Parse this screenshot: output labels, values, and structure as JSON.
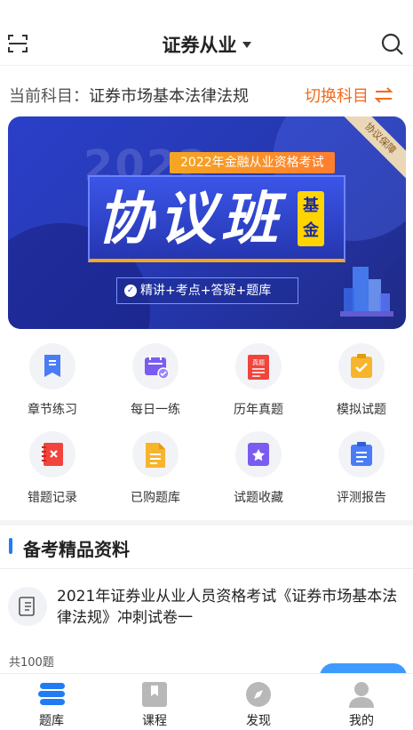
{
  "header": {
    "title": "证券从业"
  },
  "subject": {
    "label": "当前科目：",
    "value": "证券市场基本法律法规",
    "switch_label": "切换科目"
  },
  "banner": {
    "bg_year": "2022",
    "tag": "2022年金融从业资格考试",
    "title": "协议班",
    "badge": "基金",
    "subtitle": "精讲+考点+答疑+题库",
    "corner": "协议保障"
  },
  "grid": [
    {
      "label": "章节练习",
      "icon": "bookmark-icon",
      "color": "#4a7cf6"
    },
    {
      "label": "每日一练",
      "icon": "calendar-check-icon",
      "color": "#7a5cf0"
    },
    {
      "label": "历年真题",
      "icon": "exam-paper-icon",
      "color": "#f0443c",
      "icon_text": "真题"
    },
    {
      "label": "模拟试题",
      "icon": "clipboard-check-icon",
      "color": "#f7b52c"
    },
    {
      "label": "错题记录",
      "icon": "error-notebook-icon",
      "color": "#f0443c"
    },
    {
      "label": "已购题库",
      "icon": "document-icon",
      "color": "#f7b52c"
    },
    {
      "label": "试题收藏",
      "icon": "star-book-icon",
      "color": "#7a5cf0"
    },
    {
      "label": "评测报告",
      "icon": "report-icon",
      "color": "#4a7cf6"
    }
  ],
  "section": {
    "title": "备考精品资料"
  },
  "material": {
    "title": "2021年证券业从业人员资格考试《证券市场基本法律法规》冲刺试卷一",
    "count": "共100题"
  },
  "nav": [
    {
      "label": "题库",
      "icon": "question-bank-icon",
      "active": true
    },
    {
      "label": "课程",
      "icon": "course-icon",
      "active": false
    },
    {
      "label": "发现",
      "icon": "compass-icon",
      "active": false
    },
    {
      "label": "我的",
      "icon": "profile-icon",
      "active": false
    }
  ],
  "colors": {
    "accent": "#f26a1b",
    "primary": "#1f7cf5",
    "banner": "#2a3fc8"
  }
}
